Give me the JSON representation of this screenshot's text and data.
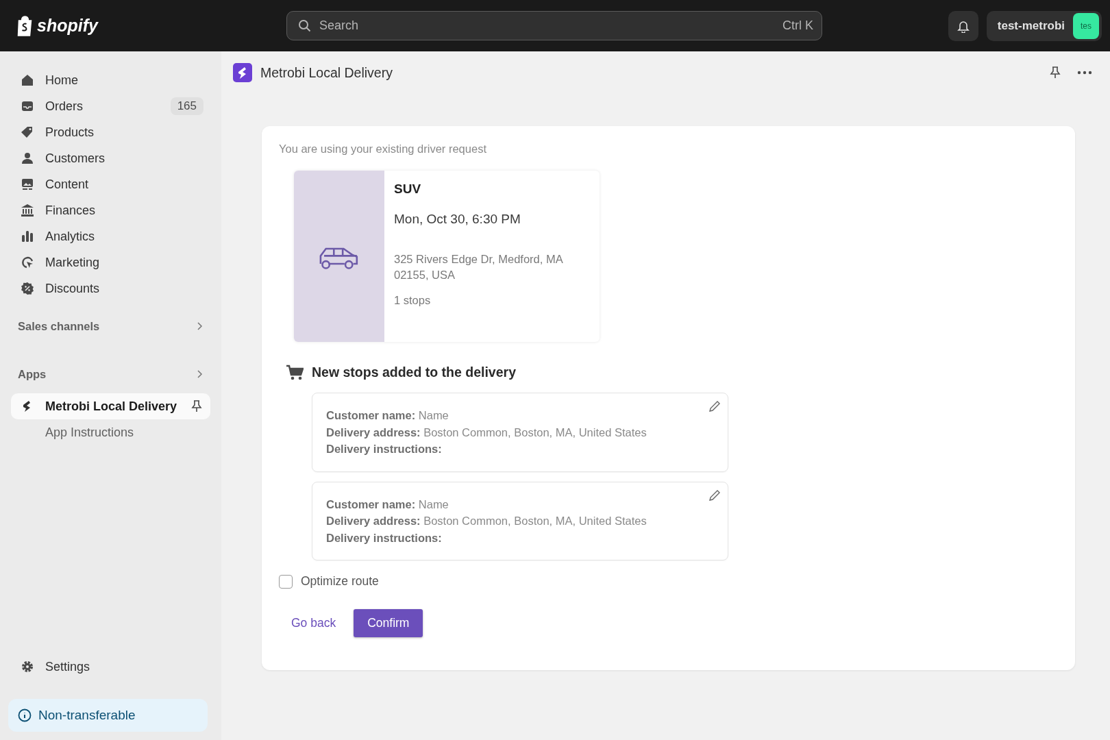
{
  "topbar": {
    "logo": "shopify",
    "search": {
      "placeholder": "Search",
      "shortcut": "Ctrl K"
    },
    "store_name": "test-metrobi",
    "avatar": "tes"
  },
  "sidebar": {
    "items": [
      {
        "label": "Home",
        "selected": false
      },
      {
        "label": "Orders",
        "selected": false,
        "badge": "165"
      },
      {
        "label": "Products",
        "selected": false
      },
      {
        "label": "Customers",
        "selected": false
      },
      {
        "label": "Content",
        "selected": false
      },
      {
        "label": "Finances",
        "selected": false
      },
      {
        "label": "Analytics",
        "selected": false
      },
      {
        "label": "Marketing",
        "selected": false
      },
      {
        "label": "Discounts",
        "selected": false
      }
    ],
    "sections": [
      "Sales channels",
      "Apps"
    ],
    "apps": [
      {
        "label": "Metrobi Local Delivery",
        "selected": true,
        "children": [
          {
            "label": "App Instructions",
            "selected": false
          }
        ]
      }
    ],
    "settings": "Settings",
    "notice": "Non-transferable"
  },
  "page": {
    "title": "Metrobi Local Delivery",
    "intro": "You are using your existing driver request",
    "vehicle": {
      "type": "SUV",
      "time": "Mon, Oct 30, 6:30 PM",
      "address": "325 Rivers Edge Dr, Medford, MA 02155, USA",
      "stops": "1 stops"
    },
    "stops_heading": "New stops added to the delivery",
    "stops": [
      {
        "fields": [
          {
            "label": "Customer name:",
            "value": "Name"
          },
          {
            "label": "Delivery address:",
            "value": "Boston Common, Boston, MA, United States"
          },
          {
            "label": "Delivery instructions:"
          }
        ]
      },
      {
        "fields": [
          {
            "label": "Customer name:",
            "value": "Name"
          },
          {
            "label": "Delivery address:",
            "value": "Boston Common, Boston, MA, United States"
          },
          {
            "label": "Delivery instructions:"
          }
        ]
      }
    ],
    "optimize": {
      "label": "Optimize route",
      "checked": false
    },
    "buttons": [
      {
        "label": "Go back",
        "kind": "plain"
      },
      {
        "label": "Confirm",
        "kind": "primary"
      }
    ]
  }
}
